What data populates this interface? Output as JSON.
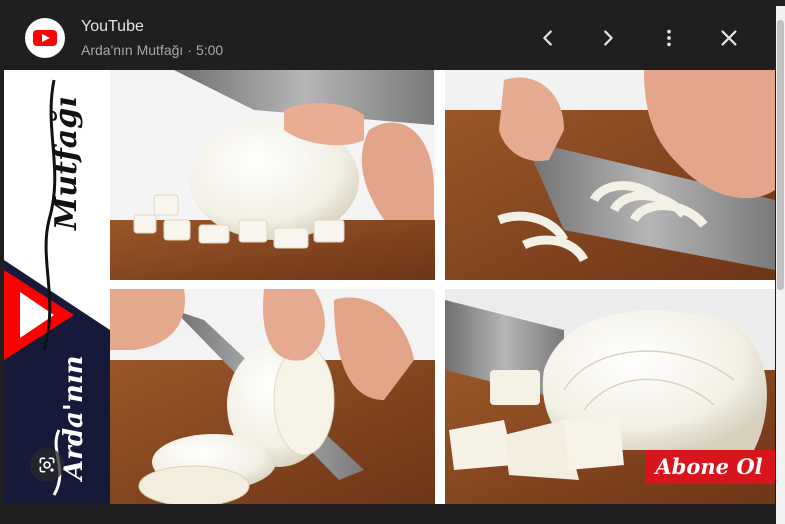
{
  "header": {
    "app_title": "YouTube",
    "channel": "Arda'nın Mutfağı",
    "separator": "·",
    "duration": "5:00"
  },
  "icons": {
    "app": "youtube-logo-icon",
    "prev": "chevron-left-icon",
    "next": "chevron-right-icon",
    "more": "more-vert-icon",
    "close": "close-icon",
    "lens": "google-lens-icon"
  },
  "thumbnail": {
    "logo_text_top": "Mutfağı",
    "logo_text_bottom": "Arda'nın",
    "cta_text": "Abone Ol"
  },
  "colors": {
    "header_bg": "#1f1f1f",
    "youtube_red": "#ff0000",
    "cutting_board": "#8b4a22",
    "logo_navy": "#16193a",
    "cta_red": "#d8151d"
  }
}
